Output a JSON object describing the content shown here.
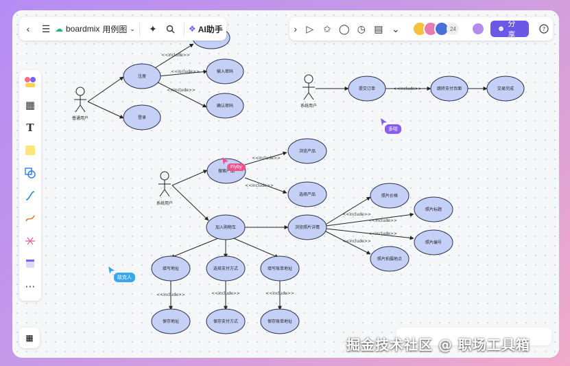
{
  "header": {
    "brand_name": "boardmix",
    "doc_title": "用例图",
    "ai_label": "AI助手",
    "collab_count": "24",
    "share_label": "分享"
  },
  "colors": {
    "accent": "#6b58e6",
    "node_fill": "#c5d0f7",
    "node_stroke": "#2b2f4a",
    "cursor_purple": "#8a5cf0",
    "cursor_pink": "#f0508c",
    "cursor_blue": "#3aa6f0"
  },
  "cursors": {
    "duoduo": "多啦",
    "flyby": "Flyby",
    "anonymous": "敌克人"
  },
  "actors": {
    "user": "普通用户",
    "system1": "系统用户",
    "system2": "系统用户"
  },
  "nodes": {
    "register": "注册",
    "login": "登录",
    "top_node": "",
    "input_password": "输入密码",
    "confirm_password": "确认密码",
    "submit_order": "提交订单",
    "jump_pay": "跳转支付页面",
    "trade_done": "交易完成",
    "search_product": "搜索产品",
    "browse_product": "浏览产品",
    "select_product": "选择产品",
    "add_cart": "加入购物车",
    "browse_detail": "浏览照片详情",
    "photo_price": "照片价格",
    "photo_tag": "照片标题",
    "photo_id": "照片编号",
    "photo_location": "照片拍摄地点",
    "fill_address": "填写地址",
    "select_pay": "选择支付方式",
    "fill_invoice": "填写账单地址",
    "save_address": "保存地址",
    "save_pay": "保存支付方式",
    "save_invoice": "保存账单地址"
  },
  "include_label": "<<include>>",
  "watermark": "掘金技术社区 @ 职场工具箱"
}
